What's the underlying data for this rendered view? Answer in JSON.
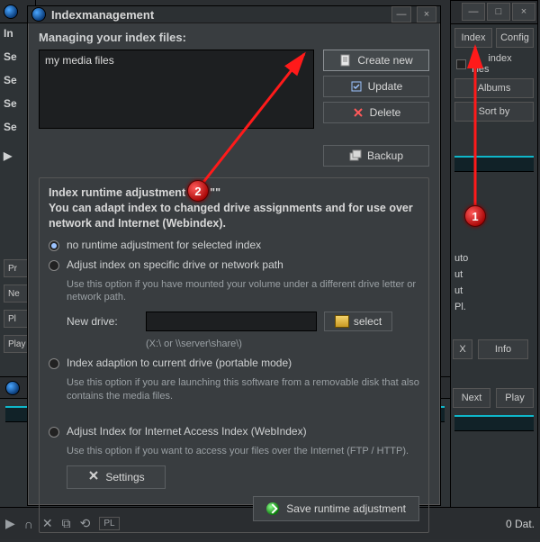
{
  "right": {
    "tab_index": "Index",
    "tab_config": "Config",
    "check_label": "index files",
    "albums": "Albums",
    "sortby": "Sort by",
    "labels": [
      "uto",
      "ut",
      "ut",
      "Pl."
    ],
    "x": "X",
    "info": "Info",
    "next": "Next",
    "play": "Play"
  },
  "left": {
    "rows": [
      "In",
      "Se",
      "Se",
      "Se",
      "Se"
    ],
    "play_glyph": "▶",
    "low": [
      "Pr",
      "Ne",
      "Pl",
      "Play"
    ]
  },
  "bottom": {
    "glyphs": [
      "▶",
      "∩",
      "✕",
      "⧉",
      "⟲",
      "PL"
    ],
    "status": "0 Dat."
  },
  "dialog": {
    "title": "Indexmanagement",
    "managing": "Managing your index files:",
    "list_item": "my media files",
    "btn_create": "Create new",
    "btn_update": "Update",
    "btn_delete": "Delete",
    "btn_backup": "Backup",
    "group_title_a": "Index runtime adjustment For \"\"",
    "group_title_b": "You can adapt index to changed drive assignments and for use over network and Internet (Webindex).",
    "opt_none": "no runtime adjustment for selected index",
    "opt_drive": "Adjust index on specific drive or network path",
    "opt_drive_help": "Use this option if you have mounted your volume under a different drive letter or network path.",
    "new_drive_label": "New drive:",
    "select_label": "select",
    "new_drive_hint": "(X:\\ or \\\\server\\share\\)",
    "opt_portable": "Index adaption to current drive (portable mode)",
    "opt_portable_help": "Use this option if you are launching this software from a removable disk that also contains the media files.",
    "opt_web": "Adjust Index for Internet Access Index (WebIndex)",
    "opt_web_help": "Use this option if you want to access your files over the Internet (FTP / HTTP).",
    "settings": "Settings",
    "save": "Save runtime adjustment"
  },
  "anno": {
    "one": "1",
    "two": "2"
  }
}
